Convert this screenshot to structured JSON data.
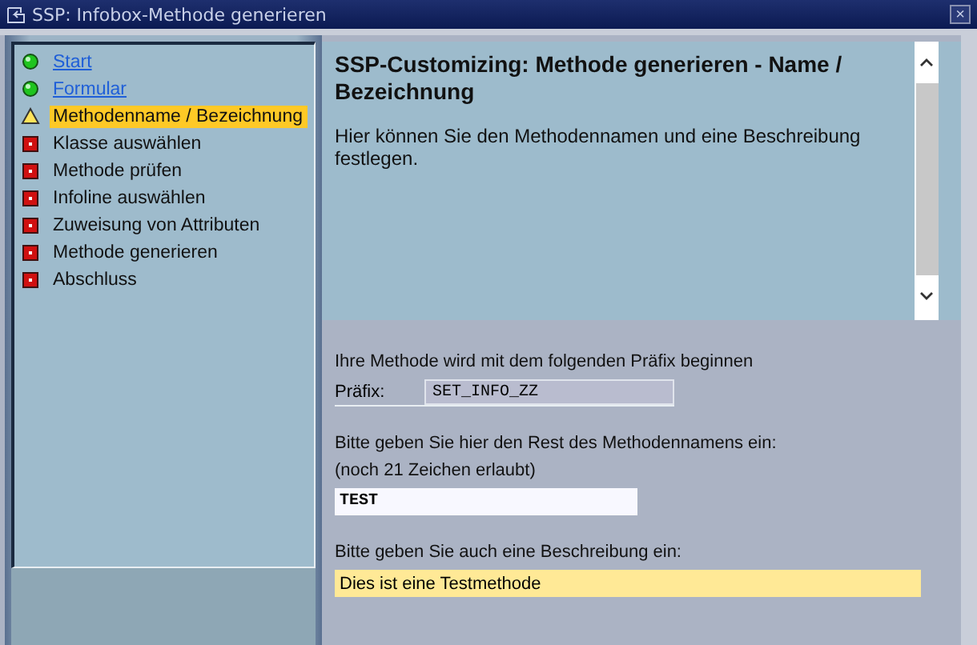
{
  "window": {
    "title": "SSP: Infobox-Methode generieren",
    "close": "×"
  },
  "steps": [
    {
      "label": "Start",
      "kind": "done",
      "selected": false
    },
    {
      "label": "Formular",
      "kind": "done",
      "selected": false
    },
    {
      "label": "Methodenname / Bezeichnung",
      "kind": "current",
      "selected": true
    },
    {
      "label": "Klasse auswählen",
      "kind": "open",
      "selected": false
    },
    {
      "label": "Methode prüfen",
      "kind": "open",
      "selected": false
    },
    {
      "label": "Infoline auswählen",
      "kind": "open",
      "selected": false
    },
    {
      "label": "Zuweisung von Attributen",
      "kind": "open",
      "selected": false
    },
    {
      "label": "Methode generieren",
      "kind": "open",
      "selected": false
    },
    {
      "label": "Abschluss",
      "kind": "open",
      "selected": false
    }
  ],
  "info": {
    "heading": "SSP-Customizing: Methode generieren - Name / Bezeichnung",
    "text": "Hier können Sie den Methodennamen und eine Beschreibung festlegen."
  },
  "form": {
    "prefix_intro": "Ihre Methode wird mit dem folgenden Präfix beginnen",
    "prefix_label": "Präfix:",
    "prefix_value": "SET_INFO_ZZ",
    "name_prompt": "Bitte geben Sie hier den Rest des Methodennamens ein:",
    "name_hint": "(noch 21 Zeichen erlaubt)",
    "name_value": "TEST",
    "desc_prompt": "Bitte geben Sie auch eine Beschreibung ein:",
    "desc_value": "Dies ist eine Testmethode"
  }
}
